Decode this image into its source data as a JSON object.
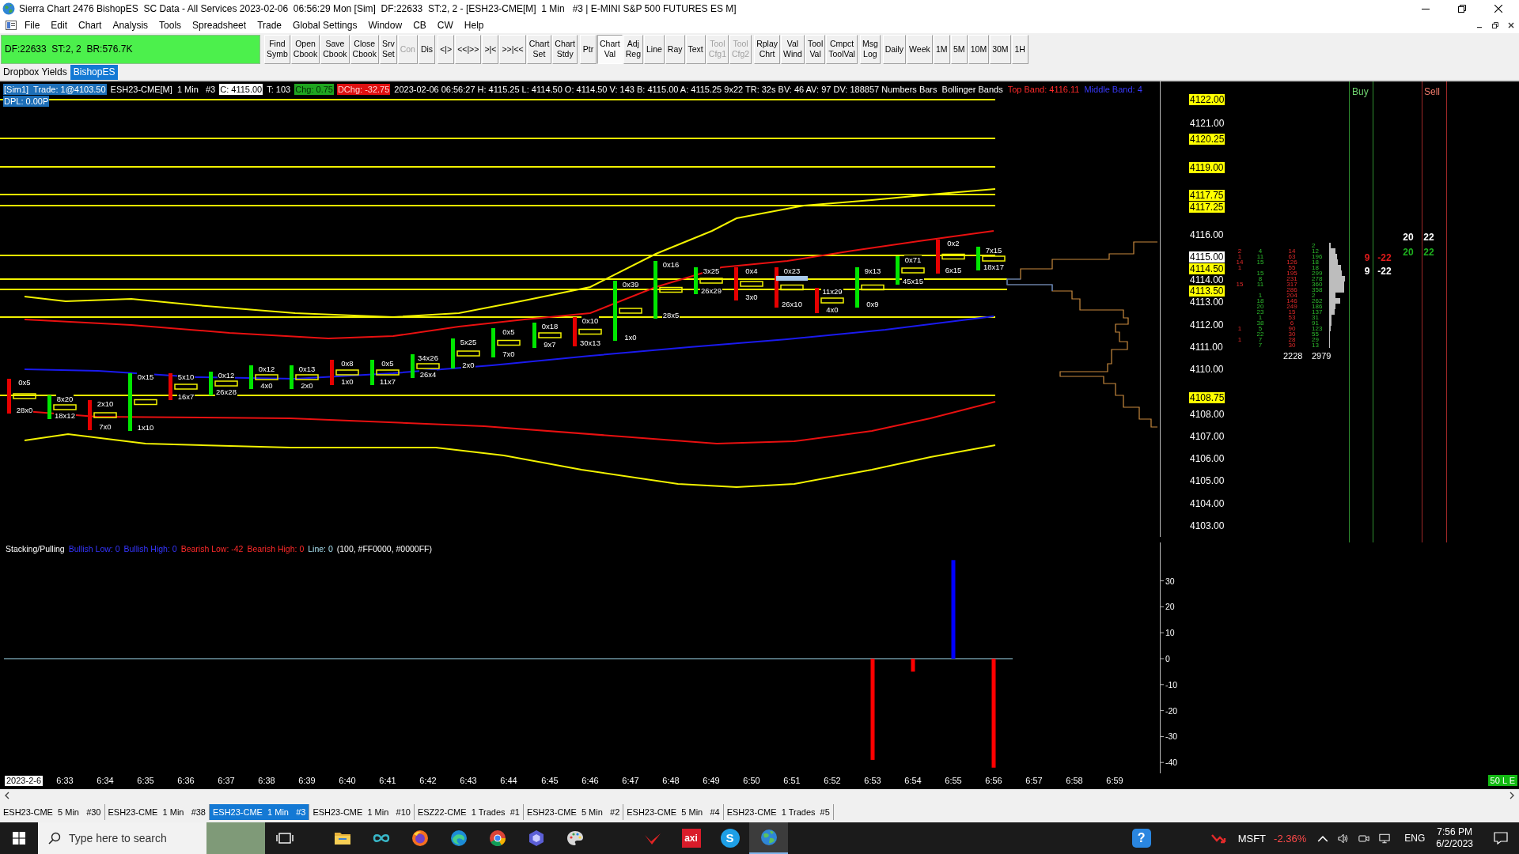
{
  "window": {
    "title": "Sierra Chart 2476 BishopES  SC Data - All Services 2023-02-06  06:56:29 Mon [Sim]  DF:22633  ST:2, 2 - [ESH23-CME[M]  1 Min   #3 | E-MINI S&P 500 FUTURES ES M]"
  },
  "menu": [
    "File",
    "Edit",
    "Chart",
    "Analysis",
    "Tools",
    "Spreadsheet",
    "Trade",
    "Global Settings",
    "Window",
    "CB",
    "CW",
    "Help"
  ],
  "toolbar": {
    "status": "DF:22633  ST:2, 2  BR:576.7K",
    "groups": [
      [
        {
          "lines": [
            "Find",
            "Symb"
          ],
          "selected": false,
          "disabled": false
        },
        {
          "lines": [
            "Open",
            "Cbook"
          ],
          "selected": false,
          "disabled": false
        },
        {
          "lines": [
            "Save",
            "Cbook"
          ],
          "selected": false,
          "disabled": false
        },
        {
          "lines": [
            "Close",
            "Cbook"
          ],
          "selected": false,
          "disabled": false
        },
        {
          "lines": [
            "Srv",
            "Set"
          ],
          "selected": false,
          "disabled": false
        },
        {
          "lines": [
            "Con"
          ],
          "selected": false,
          "disabled": true
        },
        {
          "lines": [
            "Dis"
          ],
          "selected": false,
          "disabled": false
        }
      ],
      [
        {
          "lines": [
            "<|>"
          ],
          "selected": false,
          "disabled": false
        },
        {
          "lines": [
            "<<|>>"
          ],
          "selected": false,
          "disabled": false
        },
        {
          "lines": [
            ">|<"
          ],
          "selected": false,
          "disabled": false
        },
        {
          "lines": [
            ">>|<<"
          ],
          "selected": false,
          "disabled": false
        },
        {
          "lines": [
            "Chart",
            "Set"
          ],
          "selected": false,
          "disabled": false
        },
        {
          "lines": [
            "Chart",
            "Stdy"
          ],
          "selected": false,
          "disabled": false
        }
      ],
      [
        {
          "lines": [
            "Ptr"
          ],
          "selected": false,
          "disabled": false
        },
        {
          "lines": [
            "Chart",
            "Val"
          ],
          "selected": true,
          "disabled": false
        },
        {
          "lines": [
            "Adj",
            "Reg"
          ],
          "selected": false,
          "disabled": false
        },
        {
          "lines": [
            "Line"
          ],
          "selected": false,
          "disabled": false
        },
        {
          "lines": [
            "Ray"
          ],
          "selected": false,
          "disabled": false
        },
        {
          "lines": [
            "Text"
          ],
          "selected": false,
          "disabled": false
        },
        {
          "lines": [
            "Tool",
            "Cfg1"
          ],
          "selected": false,
          "disabled": true
        },
        {
          "lines": [
            "Tool",
            "Cfg2"
          ],
          "selected": false,
          "disabled": true
        }
      ],
      [
        {
          "lines": [
            "Rplay",
            "Chrt"
          ],
          "selected": false,
          "disabled": false
        },
        {
          "lines": [
            "Val",
            "Wind"
          ],
          "selected": false,
          "disabled": false
        },
        {
          "lines": [
            "Tool",
            "Val"
          ],
          "selected": false,
          "disabled": false
        },
        {
          "lines": [
            "Cmpct",
            "ToolVal"
          ],
          "selected": false,
          "disabled": false
        }
      ],
      [
        {
          "lines": [
            "Msg",
            "Log"
          ],
          "selected": false,
          "disabled": false
        }
      ],
      [
        {
          "lines": [
            "Daily"
          ],
          "selected": false,
          "disabled": false
        },
        {
          "lines": [
            "Week"
          ],
          "selected": false,
          "disabled": false
        },
        {
          "lines": [
            "1M"
          ],
          "selected": false,
          "disabled": false
        },
        {
          "lines": [
            "5M"
          ],
          "selected": false,
          "disabled": false
        },
        {
          "lines": [
            "10M"
          ],
          "selected": false,
          "disabled": false
        },
        {
          "lines": [
            "30M"
          ],
          "selected": false,
          "disabled": false
        },
        {
          "lines": [
            "1H"
          ],
          "selected": false,
          "disabled": false
        }
      ]
    ]
  },
  "chartbook_tabs": [
    {
      "label": "Dropbox Yields",
      "selected": false
    },
    {
      "label": "BishopES",
      "selected": true
    }
  ],
  "chart": {
    "header": {
      "line_1": [
        {
          "text": "[Sim1]  Trade: 1@4103.50",
          "kind": "account"
        },
        {
          "text": "ESH23-CME[M]  1 Min   #3",
          "kind": "plain"
        },
        {
          "text": "C: 4115.00",
          "kind": "price-box"
        },
        {
          "text": "T: 103",
          "kind": "plain"
        },
        {
          "text": "Chg: 0.75",
          "kind": "up-box"
        },
        {
          "text": "DChg: -32.75",
          "kind": "down-box"
        },
        {
          "text": "2023-02-06 06:56:27 H: 4115.25 L: 4114.50 O: 4114.50 V: 143 B: 4115.00 A: 4115.25 9x22 TR: 32s BV: 46 AV: 97 DV: 188857 Numbers Bars  Bollinger Bands",
          "kind": "plain"
        },
        {
          "text": "Top Band: 4116.11",
          "kind": "red"
        },
        {
          "text": "Middle Band: 4",
          "kind": "blue"
        }
      ],
      "line_2": [
        {
          "text": "DPL: 0.00P",
          "kind": "pnl-box"
        }
      ]
    },
    "price_axis": [
      {
        "label": "4122.00",
        "kind": "level"
      },
      {
        "label": "4121.00",
        "kind": "plain"
      },
      {
        "label": "4120.25",
        "kind": "level"
      },
      {
        "label": "4119.00",
        "kind": "level"
      },
      {
        "label": "4117.75",
        "kind": "level"
      },
      {
        "label": "4117.25",
        "kind": "level"
      },
      {
        "label": "4116.00",
        "kind": "plain"
      },
      {
        "label": "4115.00",
        "kind": "last"
      },
      {
        "label": "4114.50",
        "kind": "level"
      },
      {
        "label": "4114.00",
        "kind": "plain"
      },
      {
        "label": "4113.50",
        "kind": "level"
      },
      {
        "label": "4113.00",
        "kind": "plain"
      },
      {
        "label": "4112.00",
        "kind": "plain"
      },
      {
        "label": "4111.00",
        "kind": "plain"
      },
      {
        "label": "4110.00",
        "kind": "plain"
      },
      {
        "label": "4108.75",
        "kind": "level"
      },
      {
        "label": "4108.00",
        "kind": "plain"
      },
      {
        "label": "4107.00",
        "kind": "plain"
      },
      {
        "label": "4106.00",
        "kind": "plain"
      },
      {
        "label": "4105.00",
        "kind": "plain"
      },
      {
        "label": "4104.00",
        "kind": "plain"
      },
      {
        "label": "4103.00",
        "kind": "plain"
      }
    ],
    "numbers_bars": [
      {
        "kind": "down",
        "top": "0x5",
        "bottom": "28x0"
      },
      {
        "kind": "up",
        "top": "8x20",
        "bottom": "18x12"
      },
      {
        "kind": "down",
        "top": "2x10",
        "bottom": "7x0"
      },
      {
        "kind": "up",
        "top": "0x15",
        "bottom": "1x10"
      },
      {
        "kind": "down",
        "top": "5x10",
        "bottom": "16x7"
      },
      {
        "kind": "up",
        "top": "0x12",
        "bottom": "26x28"
      },
      {
        "kind": "up",
        "top": "0x12",
        "bottom": "4x0"
      },
      {
        "kind": "up",
        "top": "0x13",
        "bottom": "2x0"
      },
      {
        "kind": "down",
        "top": "0x8",
        "bottom": "1x0"
      },
      {
        "kind": "up",
        "top": "0x5",
        "bottom": "11x7"
      },
      {
        "kind": "up",
        "top": "34x26",
        "bottom": "26x4"
      },
      {
        "kind": "up",
        "top": "5x25",
        "bottom": "2x0"
      },
      {
        "kind": "up",
        "top": "0x5",
        "bottom": "7x0"
      },
      {
        "kind": "up",
        "top": "0x18",
        "bottom": "9x7"
      },
      {
        "kind": "down",
        "top": "0x10",
        "bottom": "30x13"
      },
      {
        "kind": "up",
        "top": "0x39",
        "bottom": "1x0"
      },
      {
        "kind": "up",
        "top": "0x16",
        "bottom": "28x5"
      },
      {
        "kind": "up",
        "top": "3x25",
        "bottom": "26x29"
      },
      {
        "kind": "down",
        "top": "0x4",
        "bottom": "3x0"
      },
      {
        "kind": "down",
        "top": "0x23",
        "bottom": "26x10"
      },
      {
        "kind": "down",
        "top": "11x29",
        "bottom": "4x0"
      },
      {
        "kind": "up",
        "top": "9x13",
        "bottom": "0x9"
      },
      {
        "kind": "up",
        "top": "0x71",
        "bottom": "45x15"
      },
      {
        "kind": "down",
        "top": "0x2",
        "bottom": "6x15"
      },
      {
        "kind": "up",
        "top": "7x15",
        "bottom": "18x17"
      }
    ],
    "volume_profile": {
      "rows": [
        {
          "column_4": "2"
        },
        {
          "column_1": "2",
          "column_2": "4",
          "column_3": "14",
          "column_4": "12"
        },
        {
          "column_1": "1",
          "column_2": "11",
          "column_3": "63",
          "column_4": "196"
        },
        {
          "column_1": "14",
          "column_2": "15",
          "column_3": "126",
          "column_4": "18"
        },
        {
          "column_1": "1",
          "column_3": "55",
          "column_4": "18"
        },
        {
          "column_2": "15",
          "column_3": "195",
          "column_4": "299"
        },
        {
          "column_2": "8",
          "column_3": "231",
          "column_4": "278"
        },
        {
          "column_1": "15",
          "column_2": "11",
          "column_3": "317",
          "column_4": "360"
        },
        {
          "column_3": "286",
          "column_4": "358"
        },
        {
          "column_2": "1",
          "column_3": "204",
          "column_4": "2"
        },
        {
          "column_2": "18",
          "column_3": "146",
          "column_4": "262"
        },
        {
          "column_2": "20",
          "column_3": "249",
          "column_4": "186"
        },
        {
          "column_2": "23",
          "column_3": "15",
          "column_4": "137"
        },
        {
          "column_2": "1",
          "column_3": "53",
          "column_4": "31"
        },
        {
          "column_2": "38",
          "column_3": "6",
          "column_4": "91"
        },
        {
          "column_1": "1",
          "column_2": "5",
          "column_3": "90",
          "column_4": "123"
        },
        {
          "column_2": "22",
          "column_3": "30",
          "column_4": "55"
        },
        {
          "column_1": "1",
          "column_2": "7",
          "column_3": "28",
          "column_4": "29"
        },
        {
          "column_2": "7",
          "column_3": "30",
          "column_4": "13"
        }
      ],
      "totals": [
        "2228",
        "2979"
      ]
    },
    "dom": {
      "buy_header": "Buy",
      "sell_header": "Sell",
      "entries": [
        {
          "color": "#ffffff",
          "values": [
            "20",
            "22"
          ]
        },
        {
          "color": "#e01b1b",
          "values": [
            "9",
            "-22"
          ]
        },
        {
          "color": "#1fb01f",
          "values": [
            "20",
            "22"
          ]
        },
        {
          "color": "#ffffff",
          "values": [
            "9",
            "-22"
          ]
        }
      ]
    }
  },
  "subgraph": {
    "study_values": [
      {
        "text": "Bullish Low: 0",
        "kind": "bullish"
      },
      {
        "text": "Bullish High: 0",
        "kind": "bullish"
      },
      {
        "text": "Bearish Low: -42",
        "kind": "bearish"
      },
      {
        "text": "Bearish High: 0",
        "kind": "bearish"
      },
      {
        "text": "Line: 0",
        "kind": "line"
      },
      {
        "text": "(100, #FF0000, #0000FF)",
        "kind": "plain"
      }
    ],
    "chart_data": {
      "type": "bar",
      "title": "Stacking/Pulling",
      "categories": [
        "2023-2-6",
        "6:33",
        "6:34",
        "6:35",
        "6:36",
        "6:37",
        "6:38",
        "6:39",
        "6:40",
        "6:41",
        "6:42",
        "6:43",
        "6:44",
        "6:45",
        "6:46",
        "6:47",
        "6:48",
        "6:49",
        "6:50",
        "6:51",
        "6:52",
        "6:53",
        "6:54",
        "6:55",
        "6:56",
        "6:57",
        "6:58",
        "6:59"
      ],
      "series": [
        {
          "color": "#0000ff",
          "values": [
            null,
            null,
            null,
            null,
            null,
            null,
            null,
            null,
            null,
            null,
            null,
            null,
            null,
            null,
            null,
            null,
            null,
            null,
            null,
            null,
            null,
            null,
            null,
            38,
            null,
            null,
            null,
            null
          ]
        },
        {
          "color": "#ff0000",
          "values": [
            null,
            null,
            null,
            null,
            null,
            null,
            null,
            null,
            null,
            null,
            null,
            null,
            null,
            null,
            null,
            null,
            null,
            null,
            null,
            null,
            null,
            -39,
            -5,
            null,
            -42,
            null,
            null,
            null
          ]
        }
      ],
      "ref_lines": [
        {
          "axis": "y",
          "value": 0,
          "color": "#9fd8ea"
        }
      ],
      "ylim": [
        -44.2,
        44.8
      ],
      "yticks": [
        30,
        20,
        10,
        0,
        -10,
        -20,
        -30,
        -40
      ]
    }
  },
  "corner_badge": "50 L E",
  "chart_tabs": [
    {
      "label": "ESH23-CME  5 Min   #30",
      "selected": false
    },
    {
      "label": "ESH23-CME  1 Min   #38",
      "selected": false
    },
    {
      "label": "ESH23-CME  1 Min   #3",
      "selected": true
    },
    {
      "label": "ESH23-CME  1 Min   #10",
      "selected": false
    },
    {
      "label": "ESZ22-CME  1 Trades  #1",
      "selected": false
    },
    {
      "label": "ESH23-CME  5 Min   #2",
      "selected": false
    },
    {
      "label": "ESH23-CME  5 Min   #4",
      "selected": false
    },
    {
      "label": "ESH23-CME  1 Trades  #5",
      "selected": false
    }
  ],
  "taskbar": {
    "search": {
      "placeholder": "Type here to search"
    },
    "apps": [
      {
        "kind": "task-view",
        "selected": false
      },
      {
        "kind": "folder",
        "selected": false
      },
      {
        "kind": "infinity",
        "selected": false
      },
      {
        "kind": "flame",
        "selected": false
      },
      {
        "kind": "wave",
        "selected": false
      },
      {
        "kind": "segments",
        "selected": false
      },
      {
        "kind": "hexagon",
        "selected": false
      },
      {
        "kind": "palette",
        "selected": false
      },
      {
        "kind": "swoosh",
        "selected": false
      },
      {
        "kind": "tile",
        "label": "axi",
        "selected": false
      },
      {
        "kind": "disc",
        "label": "S",
        "selected": false
      },
      {
        "kind": "globe",
        "selected": true
      }
    ],
    "help": "?",
    "ticker": {
      "symbol": "MSFT",
      "change": "-2.36%"
    },
    "language": "ENG",
    "time": "7:56 PM",
    "date": "6/2/2023"
  }
}
